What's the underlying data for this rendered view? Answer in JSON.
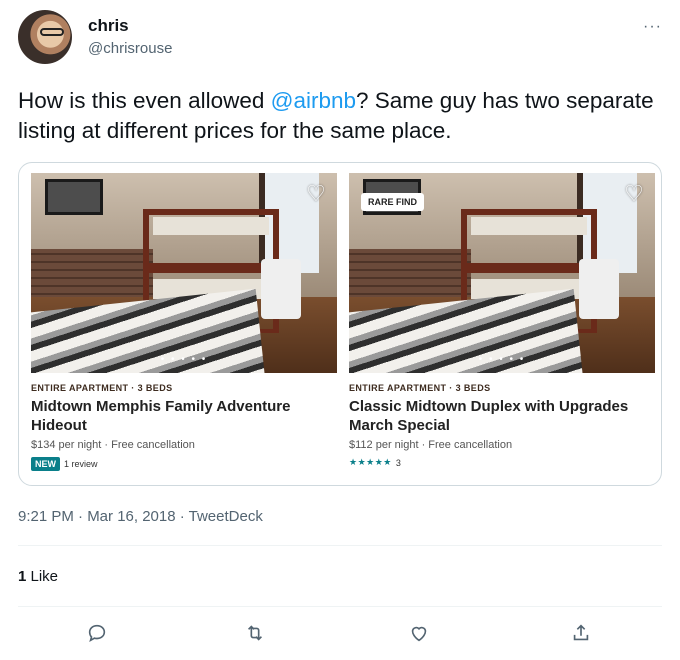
{
  "author": {
    "display_name": "chris",
    "handle": "@chrisrouse"
  },
  "more_label": "···",
  "tweet": {
    "text_before": "How is this even allowed ",
    "mention": "@airbnb",
    "text_after": "? Same guy has two separate listing at different prices for the same place."
  },
  "listings": [
    {
      "meta": "ENTIRE APARTMENT · 3 BEDS",
      "title": "Midtown Memphis Family Adventure Hideout",
      "price": "$134 per night · Free cancellation",
      "badge": "NEW",
      "reviews": "1 review"
    },
    {
      "rare_badge": "RARE FIND",
      "meta": "ENTIRE APARTMENT · 3 BEDS",
      "title": "Classic Midtown Duplex with Upgrades March Special",
      "price": "$112 per night · Free cancellation",
      "stars": "★★★★★",
      "rating_count": "3"
    }
  ],
  "timestamp": "9:21 PM · Mar 16, 2018 · TweetDeck",
  "likes": {
    "count": "1",
    "label": " Like"
  },
  "actions": [
    "reply-icon",
    "retweet-icon",
    "like-icon",
    "share-icon"
  ]
}
